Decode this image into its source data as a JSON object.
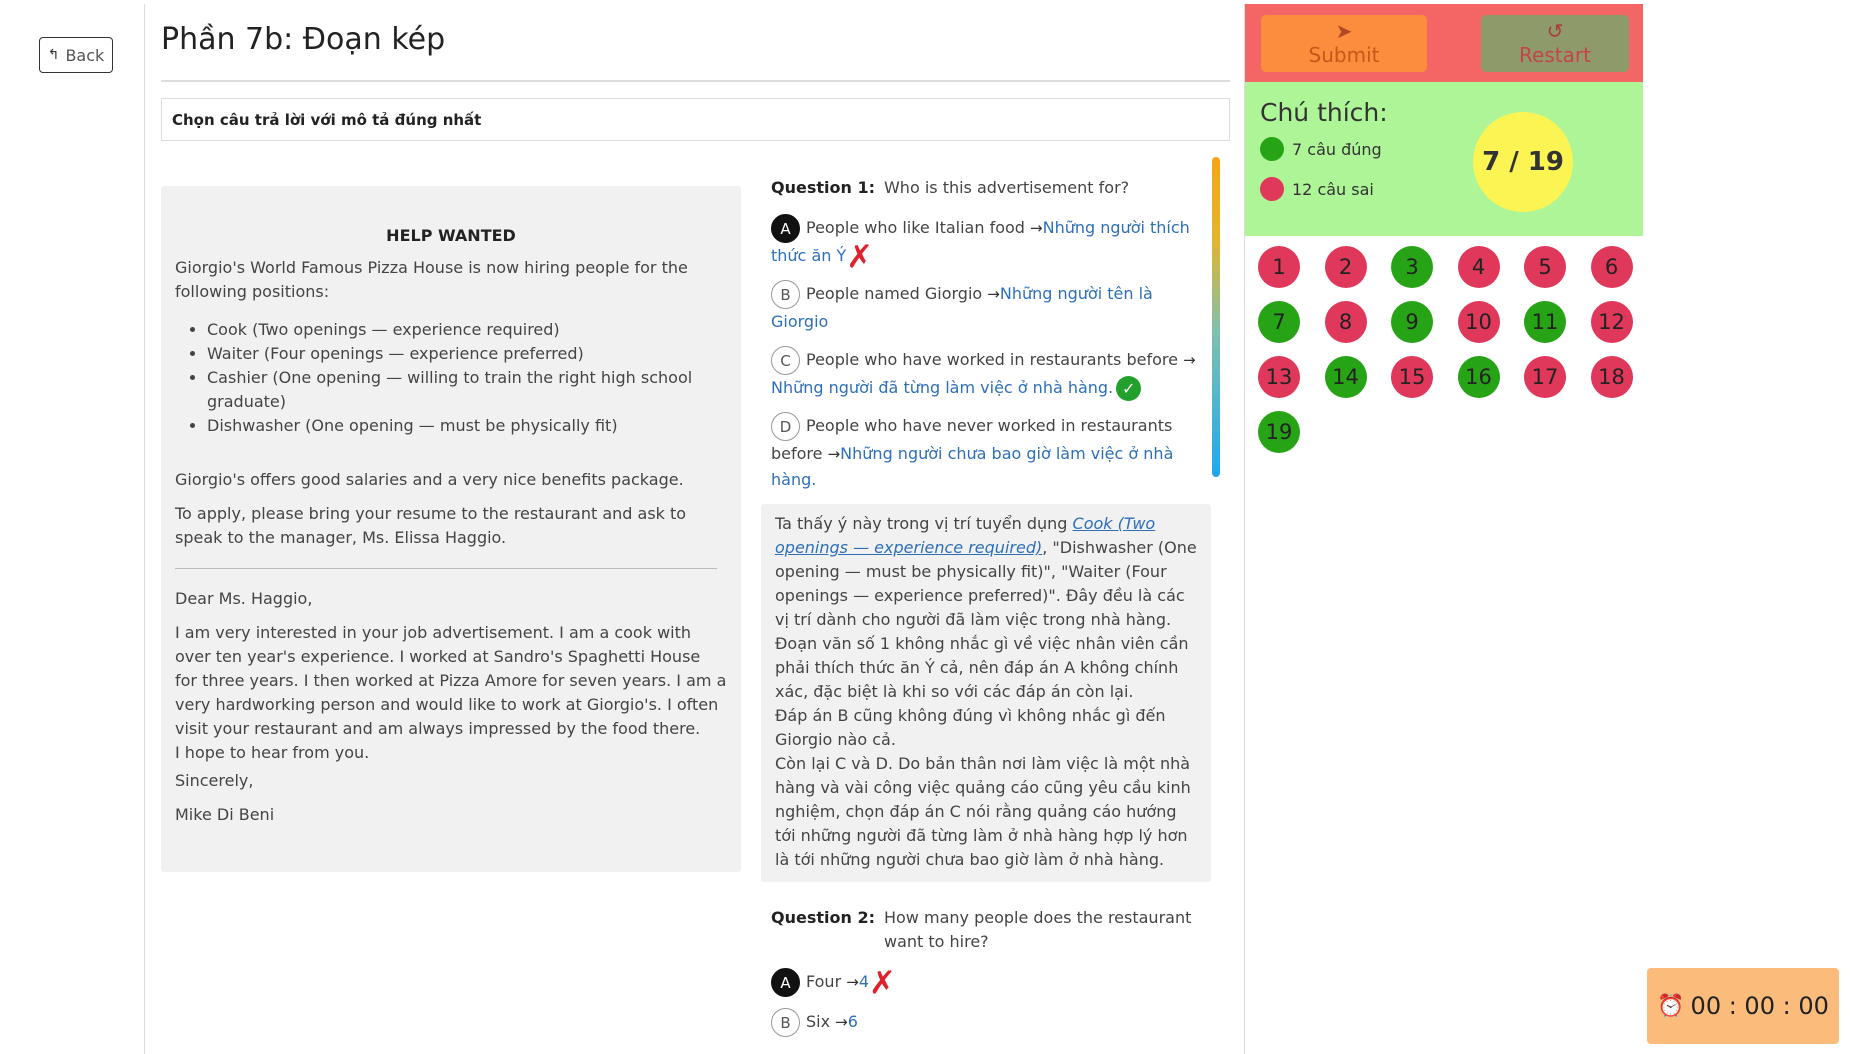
{
  "nav": {
    "back_label": "Back"
  },
  "page": {
    "title": "Phần 7b: Đoạn kép",
    "instruction": "Chọn câu trả lời với mô tả đúng nhất"
  },
  "passage": {
    "heading": "HELP WANTED",
    "intro": "Giorgio's World Famous Pizza House is now hiring people for the following positions:",
    "positions": [
      "Cook (Two openings — experience required)",
      "Waiter (Four openings — experience preferred)",
      "Cashier (One opening — willing to train the right high school graduate)",
      "Dishwasher (One opening — must be physically fit)"
    ],
    "benefits": "Giorgio's offers good salaries and a very nice benefits package.",
    "apply": "To apply, please bring your resume to the restaurant and ask to speak to the manager, Ms. Elissa Haggio.",
    "letter_greeting": "Dear Ms. Haggio,",
    "letter_body": "I am very interested in your job advertisement. I am a cook with over ten year's experience. I worked at Sandro's Spaghetti House for three years. I then worked at Pizza Amore for seven years. I am a very hardworking person and would like to work at Giorgio's. I often visit your restaurant and am always impressed by the food there.",
    "letter_hope": "I hope to hear from you.",
    "letter_closing": "Sincerely,",
    "letter_signature": "Mike Di Beni"
  },
  "q1": {
    "number": "Question 1:",
    "text": "Who is this advertisement for?",
    "options": [
      {
        "letter": "A",
        "text": "People who like Italian food",
        "translation": "Những người thích thức ăn Ý",
        "selected": true,
        "mark": "wrong"
      },
      {
        "letter": "B",
        "text": "People named Giorgio",
        "translation": "Những người tên là Giorgio",
        "selected": false,
        "mark": ""
      },
      {
        "letter": "C",
        "text": "People who have worked in restaurants before",
        "translation": "Những người đã từng làm việc ở nhà hàng.",
        "selected": false,
        "mark": "correct"
      },
      {
        "letter": "D",
        "text": "People who have never worked in restaurants before",
        "translation": "Những người chưa bao giờ làm việc ở nhà hàng.",
        "selected": false,
        "mark": ""
      }
    ],
    "explanation_prefix": "Ta thấy ý này trong vị trí tuyển dụng ",
    "explanation_ref": "Cook (Two openings — experience required)",
    "explanation_rest": ", \"Dishwasher (One opening — must be physically fit)\", \"Waiter (Four openings — experience preferred)\". Đây đều là các vị trí dành cho người đã làm việc trong nhà hàng.",
    "explanation_l2": "Đoạn văn số 1 không nhắc gì về việc nhân viên cần phải thích thức ăn Ý cả, nên đáp án A không chính xác, đặc biệt là khi so với các đáp án còn lại.",
    "explanation_l3": "Đáp án B cũng không đúng vì không nhắc gì đến Giorgio nào cả.",
    "explanation_l4": "Còn lại C và D. Do bản thân nơi làm việc là một nhà hàng và vài công việc quảng cáo cũng yêu cầu kinh nghiệm, chọn đáp án C nói rằng quảng cáo hướng tới những người đã từng làm ở nhà hàng hợp lý hơn là tới những người chưa bao giờ làm ở nhà hàng."
  },
  "q2": {
    "number": "Question 2:",
    "text": "How many people does the restaurant want to hire?",
    "options": [
      {
        "letter": "A",
        "text": "Four",
        "translation": "4",
        "selected": true,
        "mark": "wrong"
      },
      {
        "letter": "B",
        "text": "Six",
        "translation": "6",
        "selected": false,
        "mark": ""
      }
    ]
  },
  "toolbar": {
    "submit_label": "Submit",
    "restart_label": "Restart",
    "submit_icon": "paper-plane-icon",
    "restart_icon": "rotate-icon"
  },
  "legend": {
    "title": "Chú thích:",
    "correct_label": "7 câu đúng",
    "wrong_label": "12 câu sai",
    "score": "7 / 19",
    "correct_color": "#26a416",
    "wrong_color": "#e0385a"
  },
  "question_grid": [
    {
      "n": "1",
      "status": "wrong"
    },
    {
      "n": "2",
      "status": "wrong"
    },
    {
      "n": "3",
      "status": "correct"
    },
    {
      "n": "4",
      "status": "wrong"
    },
    {
      "n": "5",
      "status": "wrong"
    },
    {
      "n": "6",
      "status": "wrong"
    },
    {
      "n": "7",
      "status": "correct"
    },
    {
      "n": "8",
      "status": "wrong"
    },
    {
      "n": "9",
      "status": "correct"
    },
    {
      "n": "10",
      "status": "wrong"
    },
    {
      "n": "11",
      "status": "correct"
    },
    {
      "n": "12",
      "status": "wrong"
    },
    {
      "n": "13",
      "status": "wrong"
    },
    {
      "n": "14",
      "status": "correct"
    },
    {
      "n": "15",
      "status": "wrong"
    },
    {
      "n": "16",
      "status": "correct"
    },
    {
      "n": "17",
      "status": "wrong"
    },
    {
      "n": "18",
      "status": "wrong"
    },
    {
      "n": "19",
      "status": "correct"
    }
  ],
  "timer": {
    "value": "00 : 00 : 00",
    "icon": "alarm-clock-icon"
  }
}
